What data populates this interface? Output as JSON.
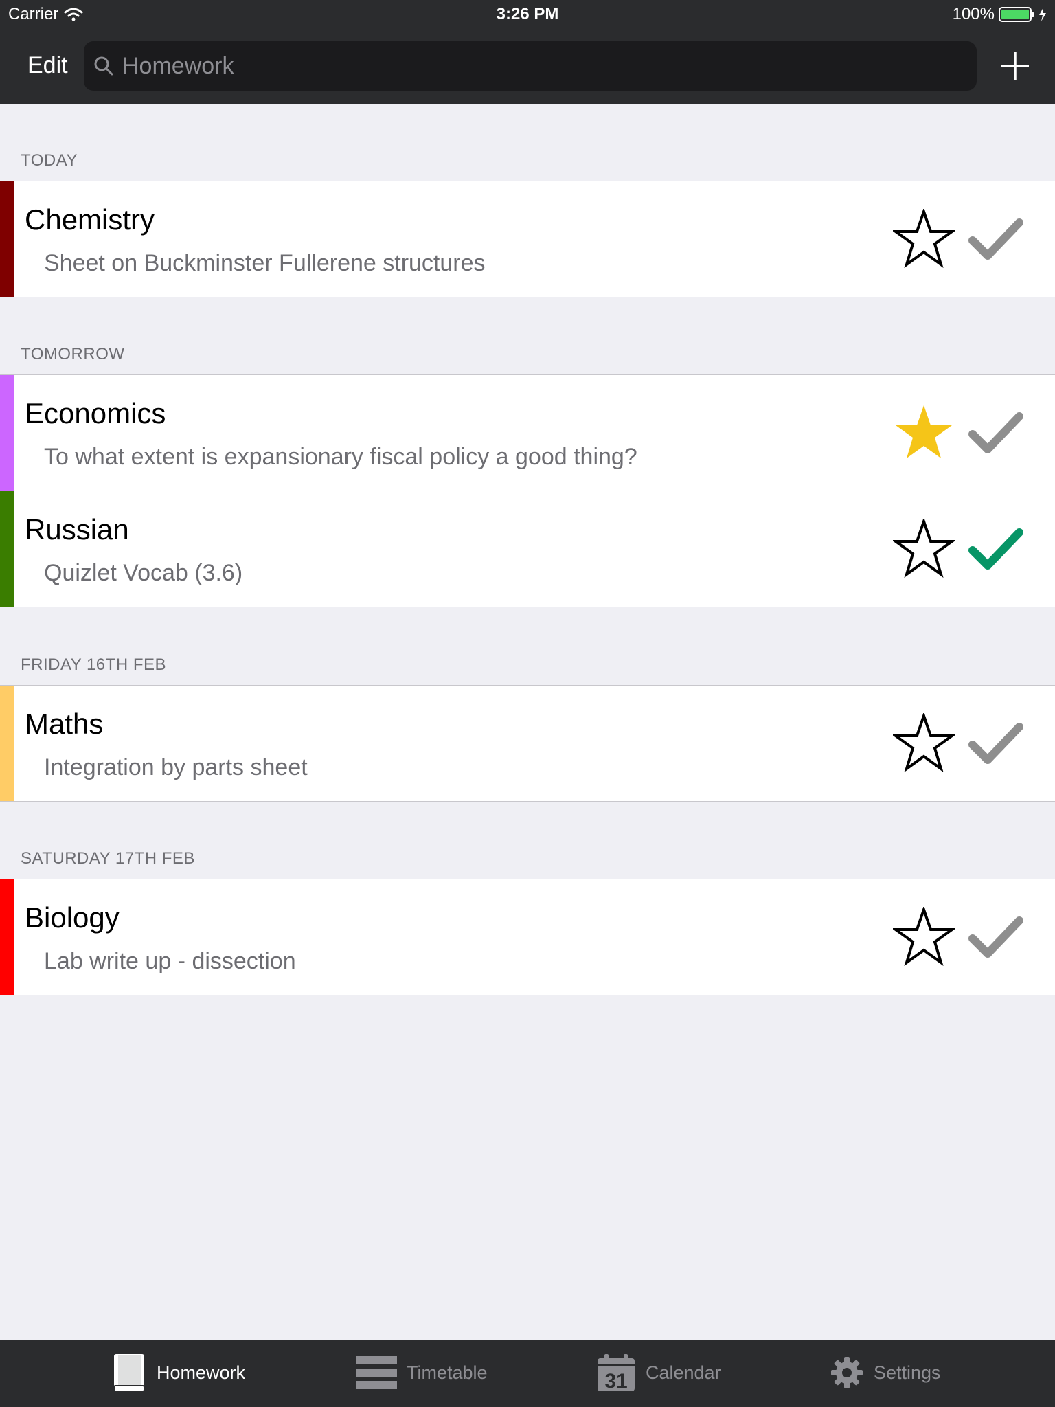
{
  "status_bar": {
    "carrier": "Carrier",
    "time": "3:26 PM",
    "battery": "100%"
  },
  "nav": {
    "edit_label": "Edit",
    "search_placeholder": "Homework"
  },
  "sections": [
    {
      "title": "TODAY"
    },
    {
      "title": "TOMORROW"
    },
    {
      "title": "FRIDAY 16TH FEB"
    },
    {
      "title": "SATURDAY 17TH FEB"
    }
  ],
  "items": [
    {
      "subject": "Chemistry",
      "description": "Sheet on Buckminster Fullerene structures",
      "color": "#7f0000",
      "starred": false,
      "done": false
    },
    {
      "subject": "Economics",
      "description": "To what extent is expansionary fiscal policy a good thing?",
      "color": "#cc66ff",
      "starred": true,
      "done": false
    },
    {
      "subject": "Russian",
      "description": "Quizlet Vocab (3.6)",
      "color": "#3a7d00",
      "starred": false,
      "done": true
    },
    {
      "subject": "Maths",
      "description": "Integration by parts sheet",
      "color": "#ffcc66",
      "starred": false,
      "done": false
    },
    {
      "subject": "Biology",
      "description": "Lab write up - dissection",
      "color": "#ff0000",
      "starred": false,
      "done": false
    }
  ],
  "tabs": [
    {
      "label": "Homework",
      "icon": "book-icon",
      "active": true
    },
    {
      "label": "Timetable",
      "icon": "timetable-icon",
      "active": false
    },
    {
      "label": "Calendar",
      "icon": "calendar-icon",
      "active": false,
      "icon_text": "31"
    },
    {
      "label": "Settings",
      "icon": "gear-icon",
      "active": false
    }
  ],
  "colors": {
    "star_filled": "#f5c518",
    "check_done": "#079566",
    "check_pending": "#8e8e8e"
  }
}
